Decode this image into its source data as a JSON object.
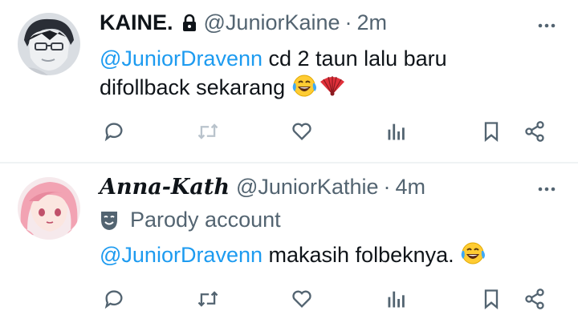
{
  "tweets": [
    {
      "display_name": "KAINE.",
      "handle": "@JuniorKaine",
      "time": "2m",
      "mention": "@JuniorDravenn",
      "text_line1": " cd 2 taun lalu baru",
      "text_line2": "difollback sekarang ",
      "emojis": [
        "face-with-tears-of-joy",
        "folding-fan"
      ],
      "protected": true
    },
    {
      "display_name": "Anna-Kath",
      "handle": "@JuniorKathie",
      "time": "4m",
      "badge": "Parody account",
      "mention": "@JuniorDravenn",
      "text": " makasih folbeknya. ",
      "emojis": [
        "face-with-tears-of-joy"
      ]
    }
  ],
  "separator": "·",
  "colors": {
    "mention": "#1d9bf0",
    "secondary_text": "#536471",
    "icon": "#536471",
    "divider": "#eff3f4"
  },
  "icons": [
    "more-icon",
    "reply-icon",
    "retweet-icon",
    "like-icon",
    "views-icon",
    "bookmark-icon",
    "share-icon",
    "lock-icon",
    "parody-mask-icon"
  ]
}
